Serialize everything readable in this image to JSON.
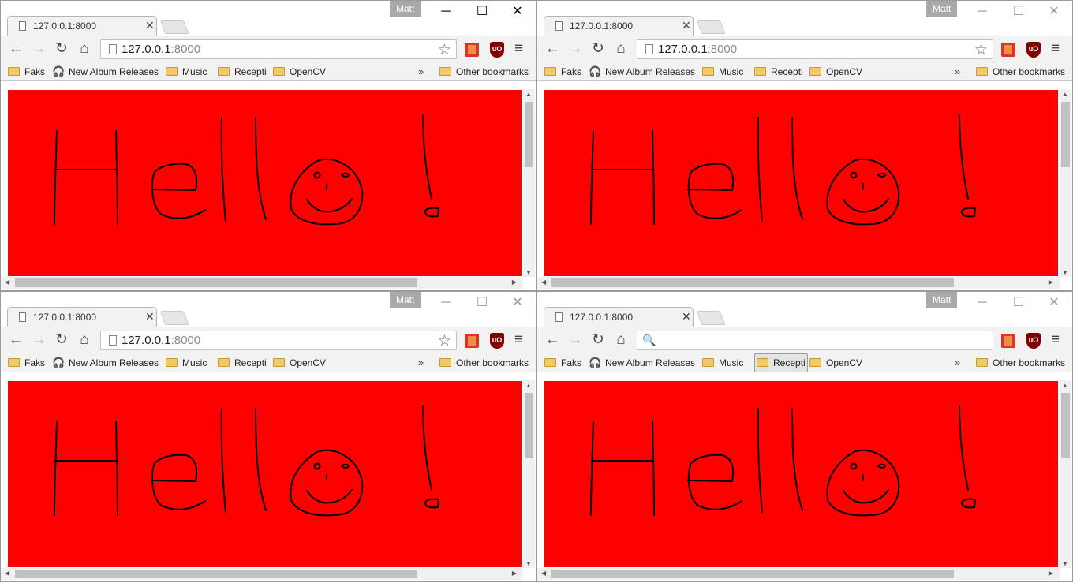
{
  "windows": [
    {
      "user": "Matt",
      "tab_title": "127.0.0.1:8000",
      "tab_close": "✕",
      "url_host": "127.0.0.1",
      "url_port": ":8000"
    },
    {
      "user": "Matt",
      "tab_title": "127.0.0.1:8000",
      "tab_close": "✕",
      "url_host": "127.0.0.1",
      "url_port": ":8000"
    },
    {
      "user": "Matt",
      "tab_title": "127.0.0.1:8000",
      "tab_close": "✕",
      "url_host": "127.0.0.1",
      "url_port": ":8000"
    },
    {
      "user": "Matt",
      "tab_title": "127.0.0.1:8000",
      "tab_close": "✕",
      "url_host": "",
      "url_port": ""
    }
  ],
  "window_controls": {
    "minimize": "─",
    "maximize": "☐",
    "close": "✕"
  },
  "nav": {
    "back": "←",
    "forward": "→",
    "reload": "↻",
    "home": "⌂",
    "menu": "≡",
    "star": "☆",
    "search": "🔍"
  },
  "extensions": {
    "ublock": "uO"
  },
  "bookmarks": {
    "items": [
      "Faks",
      "New Album Releases",
      "Music",
      "Recepti",
      "OpenCV"
    ],
    "overflow": "»",
    "other": "Other bookmarks"
  },
  "colors": {
    "canvas_bg": "#ff0000",
    "ink": "#000000"
  },
  "icons": [
    "back-icon",
    "forward-icon",
    "reload-icon",
    "home-icon",
    "star-icon",
    "menu-icon",
    "folder-icon",
    "headphones-icon",
    "page-icon",
    "search-icon"
  ]
}
